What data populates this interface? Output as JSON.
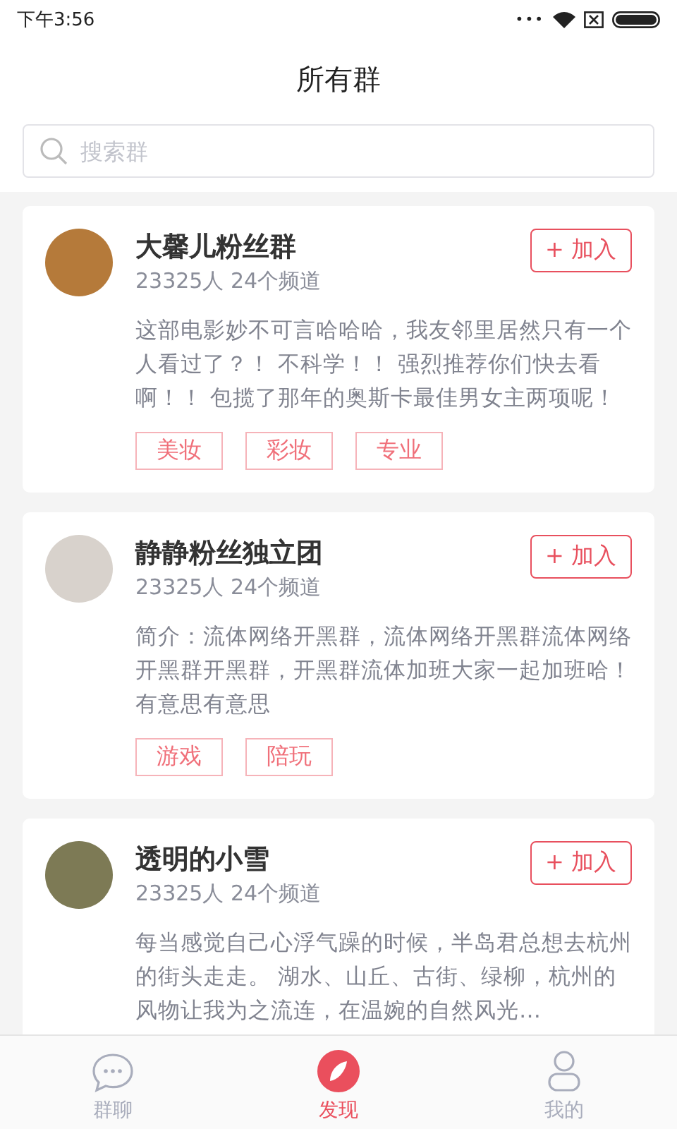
{
  "status_bar": {
    "time": "下午3:56",
    "dots": "•••"
  },
  "header": {
    "title": "所有群"
  },
  "search": {
    "placeholder": "搜索群"
  },
  "groups": [
    {
      "name": "大馨儿粉丝群",
      "stats": "23325人 24个频道",
      "join": "+ 加入",
      "description": "这部电影妙不可言哈哈哈，我友邻里居然只有一个人看过了？！ 不科学！！ 强烈推荐你们快去看啊！！ 包揽了那年的奥斯卡最佳男女主两项呢！",
      "tags": [
        "美妆",
        "彩妆",
        "专业"
      ]
    },
    {
      "name": "静静粉丝独立团",
      "stats": "23325人 24个频道",
      "join": "+ 加入",
      "description": "简介：流体网络开黑群，流体网络开黑群流体网络开黑群开黑群，开黑群流体加班大家一起加班哈！有意思有意思",
      "tags": [
        "游戏",
        "陪玩"
      ]
    },
    {
      "name": "透明的小雪",
      "stats": "23325人 24个频道",
      "join": "+ 加入",
      "description": "每当感觉自己心浮气躁的时候，半岛君总想去杭州的街头走走。 湖水、山丘、古街、绿柳，杭州的风物让我为之流连，在温婉的自然风光…"
    }
  ],
  "tab_bar": [
    {
      "kind": "chat",
      "label": "群聊",
      "selected": false
    },
    {
      "kind": "discover",
      "label": "发现",
      "selected": true
    },
    {
      "kind": "profile",
      "label": "我的",
      "selected": false
    }
  ]
}
